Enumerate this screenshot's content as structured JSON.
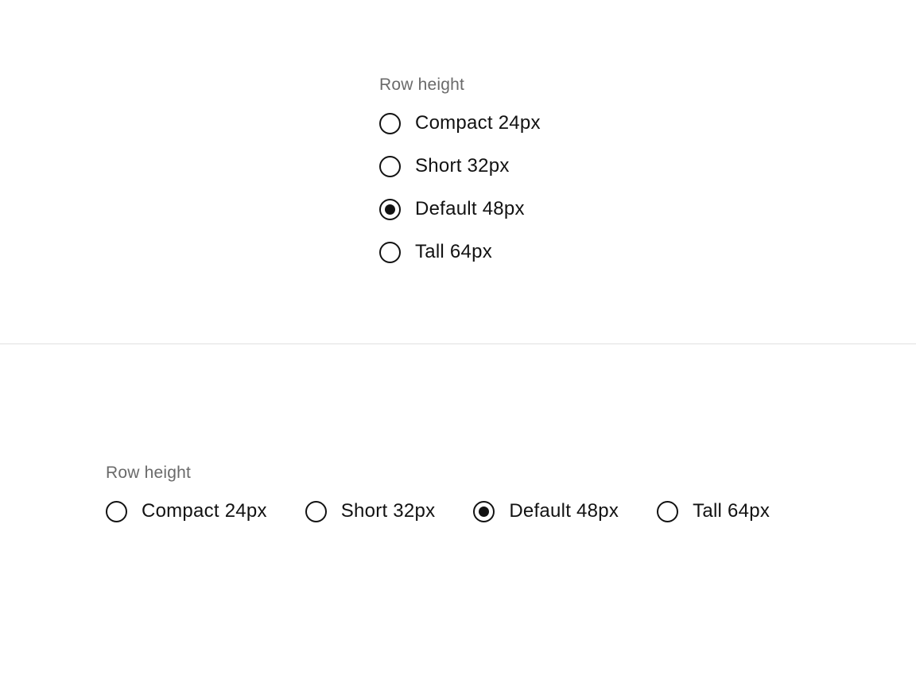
{
  "vertical_group": {
    "label": "Row height",
    "options": [
      {
        "label": "Compact 24px",
        "checked": false
      },
      {
        "label": "Short 32px",
        "checked": false
      },
      {
        "label": "Default 48px",
        "checked": true
      },
      {
        "label": "Tall 64px",
        "checked": false
      }
    ]
  },
  "horizontal_group": {
    "label": "Row height",
    "options": [
      {
        "label": "Compact 24px",
        "checked": false
      },
      {
        "label": "Short 32px",
        "checked": false
      },
      {
        "label": "Default 48px",
        "checked": true
      },
      {
        "label": "Tall 64px",
        "checked": false
      }
    ]
  }
}
